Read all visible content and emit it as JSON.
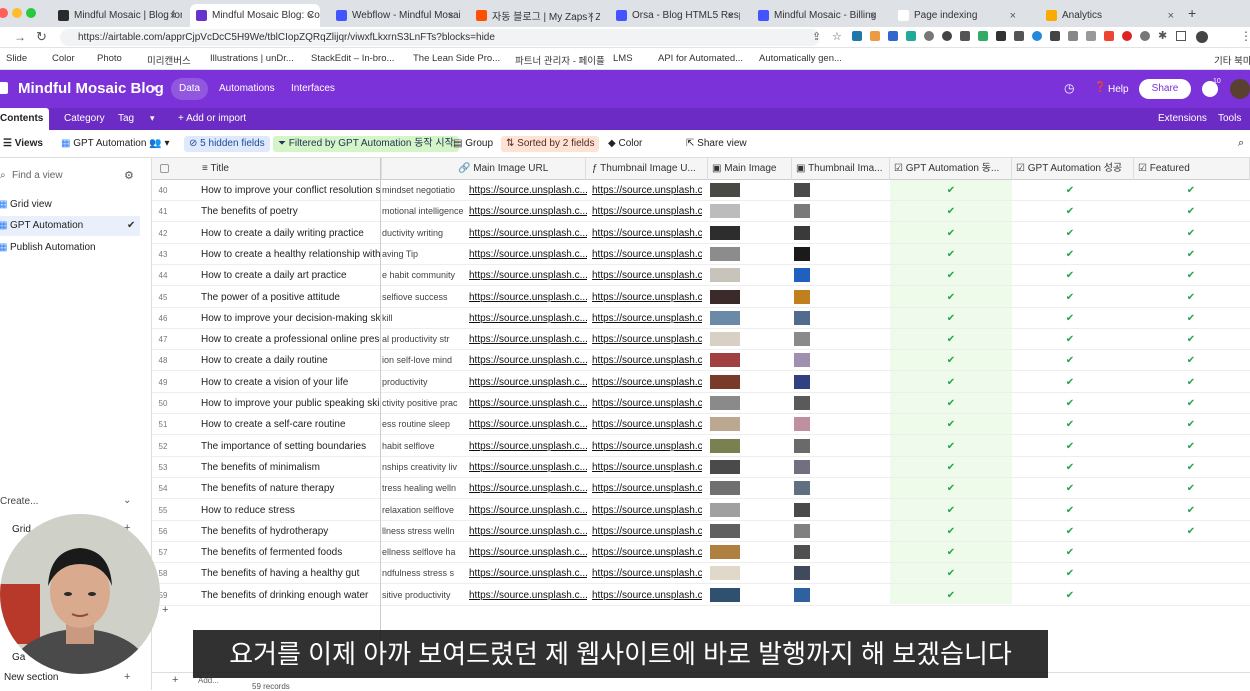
{
  "browser": {
    "tabs": [
      {
        "title": "Mindful Mosaic | Blog for",
        "color": "#2a2a2a"
      },
      {
        "title": "Mindful Mosaic Blog: Con",
        "color": "#6633cc"
      },
      {
        "title": "Webflow - Mindful Mosaic",
        "color": "#4353ff"
      },
      {
        "title": "자동 블로그 | My Zaps | Zap",
        "color": "#ff4f00"
      },
      {
        "title": "Orsa - Blog HTML5 Respo",
        "color": "#4353ff"
      },
      {
        "title": "Mindful Mosaic - Billing",
        "color": "#4353ff"
      },
      {
        "title": "Page indexing",
        "color": "#ffffff"
      },
      {
        "title": "Analytics",
        "color": "#f9ab00"
      }
    ],
    "url": "https://airtable.com/apprCjpVcDcC5H9We/tblCIopZQRqZlijqr/viwxfLkxrnS3LnFTs?blocks=hide",
    "bookmarks": [
      "Slide",
      "Color",
      "Photo",
      "미리캔버스",
      "Illustrations | unDr...",
      "StackEdit – In-bro...",
      "The Lean Side Pro...",
      "파트너 관리자 - 페이플",
      "LMS",
      "API for Automated...",
      "Automatically gen...",
      "기타 북마크"
    ]
  },
  "app": {
    "base_name": "Mindful Mosaic Blog",
    "nav": [
      "Data",
      "Automations",
      "Interfaces"
    ],
    "help": "Help",
    "share": "Share",
    "notif_count": "10",
    "table_tabs": [
      "Contents",
      "Category",
      "Tag"
    ],
    "add_import": "+ Add or import",
    "extensions": "Extensions",
    "tools": "Tools",
    "accent": "#7b32d8"
  },
  "toolbar": {
    "views": "Views",
    "current_view": "GPT Automation",
    "hidden_fields": "5 hidden fields",
    "filter": "Filtered by GPT Automation 동작 시작",
    "group": "Group",
    "sort": "Sorted by 2 fields",
    "color": "Color",
    "share_view": "Share view"
  },
  "sidebar": {
    "find_placeholder": "Find a view",
    "views": [
      "Grid view",
      "GPT Automation",
      "Publish Automation"
    ],
    "create": "Create...",
    "create_items": [
      "Grid",
      "Ga"
    ],
    "new_section": "New section"
  },
  "grid": {
    "columns": [
      "Title",
      "Main Image URL",
      "Thumbnail Image U...",
      "Main Image",
      "Thumbnail Ima...",
      "GPT Automation 동...",
      "GPT Automation 성공",
      "Featured"
    ],
    "rows": [
      {
        "n": "40",
        "title": "How to improve your conflict resolution sk...",
        "tags": "mindset  negotiatio",
        "url": "https://source.unsplash.c...",
        "gpt": true,
        "ok": true,
        "feat": true
      },
      {
        "n": "41",
        "title": "The benefits of poetry",
        "tags": "motional intelligence",
        "url": "https://source.unsplash.c...",
        "gpt": true,
        "ok": true,
        "feat": true
      },
      {
        "n": "42",
        "title": "How to create a daily writing practice",
        "tags": "ductivity  writing",
        "url": "https://source.unsplash.c...",
        "gpt": true,
        "ok": true,
        "feat": true
      },
      {
        "n": "43",
        "title": "How to create a healthy relationship with ...",
        "tags": "aving  Tip",
        "url": "https://source.unsplash.c...",
        "gpt": true,
        "ok": true,
        "feat": true
      },
      {
        "n": "44",
        "title": "How to create a daily art practice",
        "tags": "e  habit  community",
        "url": "https://source.unsplash.c...",
        "gpt": true,
        "ok": true,
        "feat": true
      },
      {
        "n": "45",
        "title": "The power of a positive attitude",
        "tags": "selfiove  success",
        "url": "https://source.unsplash.c...",
        "gpt": true,
        "ok": true,
        "feat": true
      },
      {
        "n": "46",
        "title": "How to improve your decision-making skills",
        "tags": "kill",
        "url": "https://source.unsplash.c...",
        "gpt": true,
        "ok": true,
        "feat": true
      },
      {
        "n": "47",
        "title": "How to create a professional online prese...",
        "tags": "al  productivity  str",
        "url": "https://source.unsplash.c...",
        "gpt": true,
        "ok": true,
        "feat": true
      },
      {
        "n": "48",
        "title": "How to create a daily routine",
        "tags": "ion  self-love  mind",
        "url": "https://source.unsplash.c...",
        "gpt": true,
        "ok": true,
        "feat": true
      },
      {
        "n": "49",
        "title": "How to create a vision of your life",
        "tags": "productivity",
        "url": "https://source.unsplash.c...",
        "gpt": true,
        "ok": true,
        "feat": true
      },
      {
        "n": "50",
        "title": "How to improve your public speaking skills",
        "tags": "ctivity  positive  prac",
        "url": "https://source.unsplash.c...",
        "gpt": true,
        "ok": true,
        "feat": true
      },
      {
        "n": "51",
        "title": "How to create a self-care routine",
        "tags": "ess  routine  sleep",
        "url": "https://source.unsplash.c...",
        "gpt": true,
        "ok": true,
        "feat": true
      },
      {
        "n": "52",
        "title": "The importance of setting boundaries",
        "tags": "habit  selflove",
        "url": "https://source.unsplash.c...",
        "gpt": true,
        "ok": true,
        "feat": true
      },
      {
        "n": "53",
        "title": "The benefits of minimalism",
        "tags": "nships  creativity  liv",
        "url": "https://source.unsplash.c...",
        "gpt": true,
        "ok": true,
        "feat": true
      },
      {
        "n": "54",
        "title": "The benefits of nature therapy",
        "tags": "tress  healing  welln",
        "url": "https://source.unsplash.c...",
        "gpt": true,
        "ok": true,
        "feat": true
      },
      {
        "n": "55",
        "title": "How to reduce stress",
        "tags": "relaxation  selflove",
        "url": "https://source.unsplash.c...",
        "gpt": true,
        "ok": true,
        "feat": true
      },
      {
        "n": "56",
        "title": "The benefits of hydrotherapy",
        "tags": "llness  stress  welln",
        "url": "https://source.unsplash.c...",
        "gpt": true,
        "ok": true,
        "feat": true
      },
      {
        "n": "57",
        "title": "The benefits of fermented foods",
        "tags": "ellness  selflove  ha",
        "url": "https://source.unsplash.c...",
        "gpt": true,
        "ok": true,
        "feat": false
      },
      {
        "n": "58",
        "title": "The benefits of having a healthy gut",
        "tags": "ndfulness  stress  s",
        "url": "https://source.unsplash.c...",
        "gpt": true,
        "ok": true,
        "feat": false
      },
      {
        "n": "59",
        "title": "The benefits of drinking enough water",
        "tags": "sitive  productivity",
        "url": "https://source.unsplash.c...",
        "gpt": true,
        "ok": true,
        "feat": false
      }
    ],
    "thumb_colors": [
      "#4a4a44",
      "#bcbcbc",
      "#2d2d2d",
      "#8c8c8c",
      "#c8c4bc",
      "#3a2a2a",
      "#6a8aa8",
      "#d8d0c4",
      "#a04040",
      "#7a3a2a",
      "#8a8a8a",
      "#bca890",
      "#7a8050",
      "#4a4a4a",
      "#707070",
      "#a0a0a0",
      "#606060",
      "#b08040",
      "#e0d8c8",
      "#305070"
    ],
    "thumb2_colors": [
      "#4a4a4a",
      "#7a7a7a",
      "#3a3a3a",
      "#1a1a1a",
      "#2060c0",
      "#c08020",
      "#506a90",
      "#8a8a8a",
      "#a090b0",
      "#304080",
      "#5a5a5a",
      "#c090a0",
      "#6a6a6a",
      "#707080",
      "#607080",
      "#4a4a4a",
      "#808080",
      "#505050",
      "#404a5a",
      "#3060a0"
    ],
    "add_label": "Add...",
    "record_count": "59 records"
  },
  "subtitle": "요거를 이제 아까 보여드렸던 제 웹사이트에 바로 발행까지 해 보겠습니다"
}
